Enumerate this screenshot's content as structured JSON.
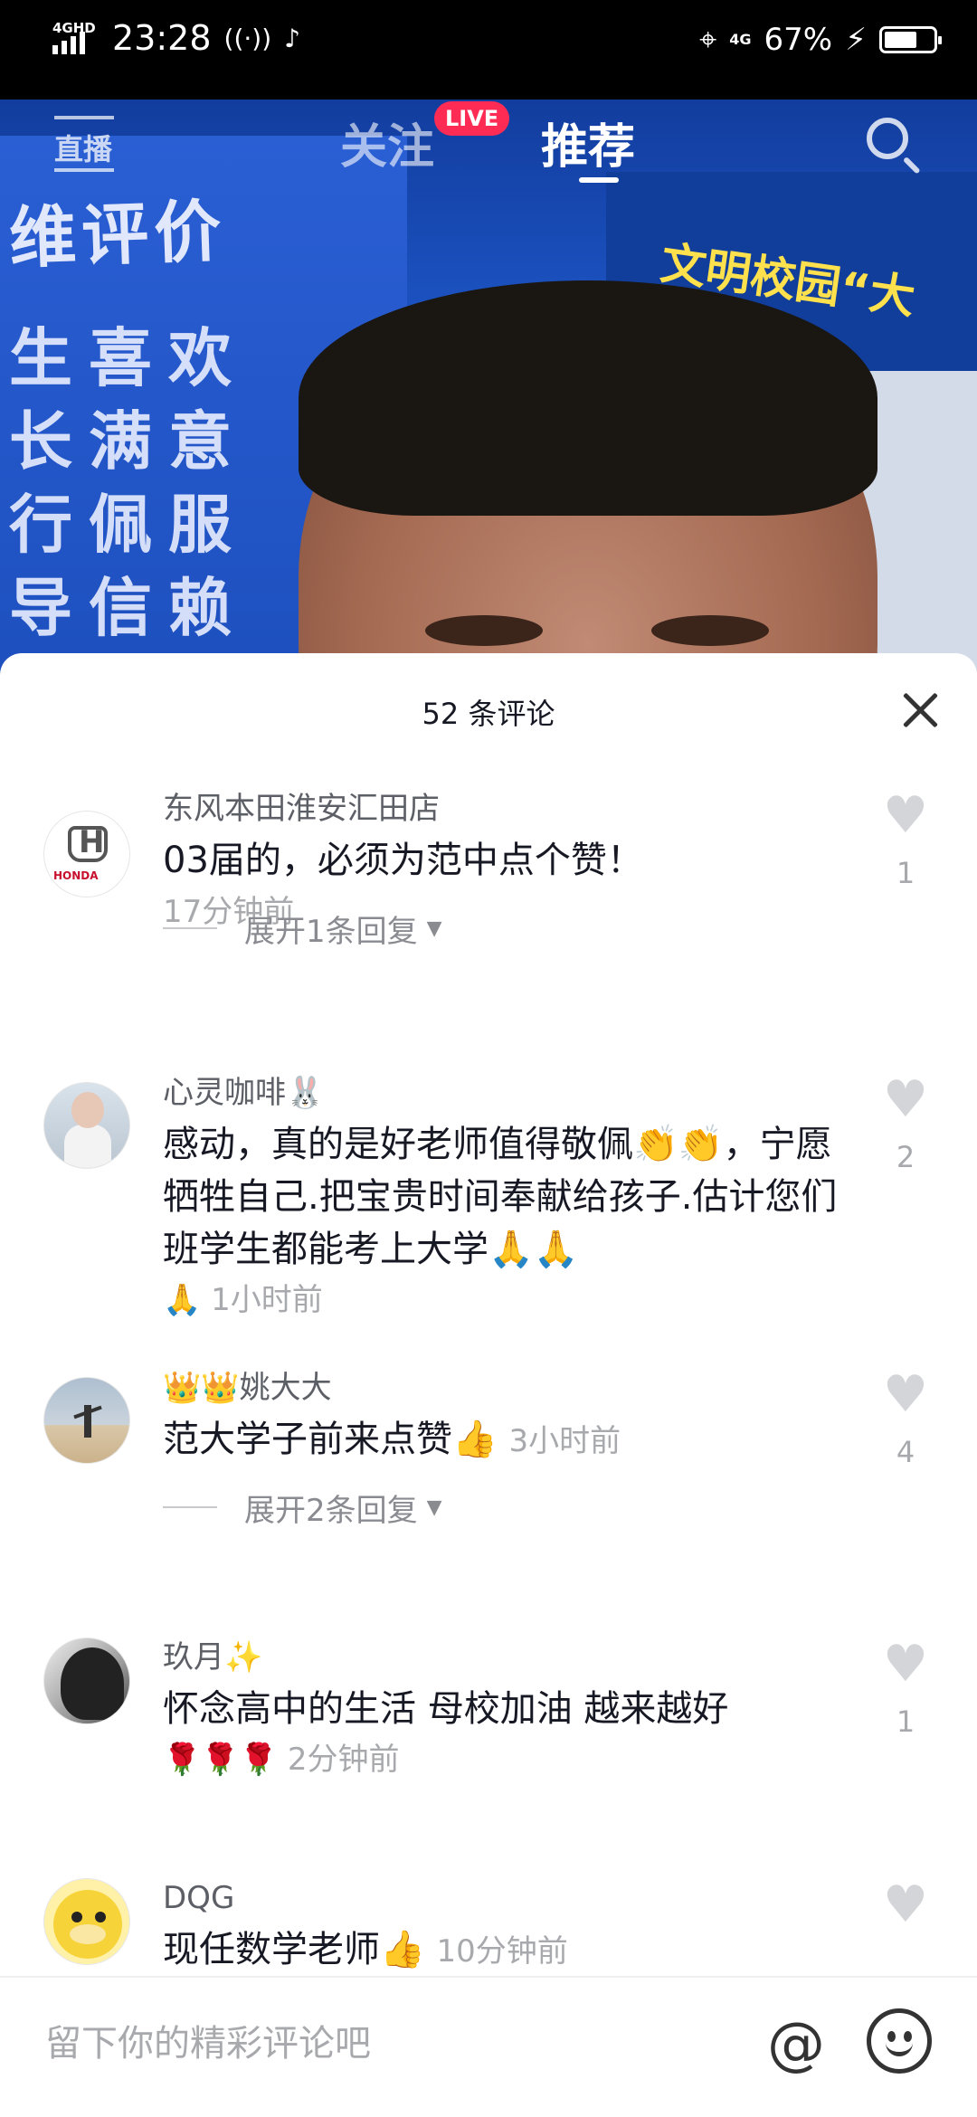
{
  "status_bar": {
    "network": "4GHD",
    "time": "23:28",
    "extra_icons": [
      "hotspot-icon",
      "tiktok-icon"
    ],
    "right_network": "4G",
    "battery": "67%",
    "battery_level": 0.67
  },
  "top_nav": {
    "live_label": "直播",
    "follow_tab": "关注",
    "live_badge": "LIVE",
    "recommend_tab": "推荐",
    "active_tab": "推荐"
  },
  "video_text": {
    "banner_title": "维评价",
    "banner_lines": [
      "生喜欢",
      "长满意",
      "行佩服",
      "导信赖"
    ],
    "right_banner": "文明校园“大"
  },
  "comments_header": {
    "title": "52 条评论"
  },
  "comments": [
    {
      "user": "东风本田淮安汇田店",
      "avatar_text": "HONDA",
      "text": "03届的，必须为范中点个赞！",
      "time": "17分钟前",
      "likes": "1",
      "expand": "展开1条回复"
    },
    {
      "user": "心灵咖啡🐰",
      "text": "感动，真的是好老师值得敬佩👏👏，宁愿牺牲自己.把宝贵时间奉献给孩子.估计您们班学生都能考上大学🙏🙏",
      "text_tail": "🙏",
      "time": "1小时前",
      "likes": "2"
    },
    {
      "user": "👑👑姚大大",
      "text": "范大学子前来点赞👍",
      "time": "3小时前",
      "likes": "4",
      "expand": "展开2条回复"
    },
    {
      "user": "玖月✨",
      "text": "怀念高中的生活 母校加油 越来越好",
      "text_tail": "🌹🌹🌹",
      "time": "2分钟前",
      "likes": "1"
    },
    {
      "user": "DQG",
      "text": "现任数学老师👍",
      "time": "10分钟前",
      "likes": ""
    }
  ],
  "input_bar": {
    "placeholder": "留下你的精彩评论吧",
    "at_symbol": "@"
  },
  "colors": {
    "live_badge": "#fe2c55",
    "sheet_bg": "#ffffff",
    "secondary_text": "#a8a9ad"
  }
}
